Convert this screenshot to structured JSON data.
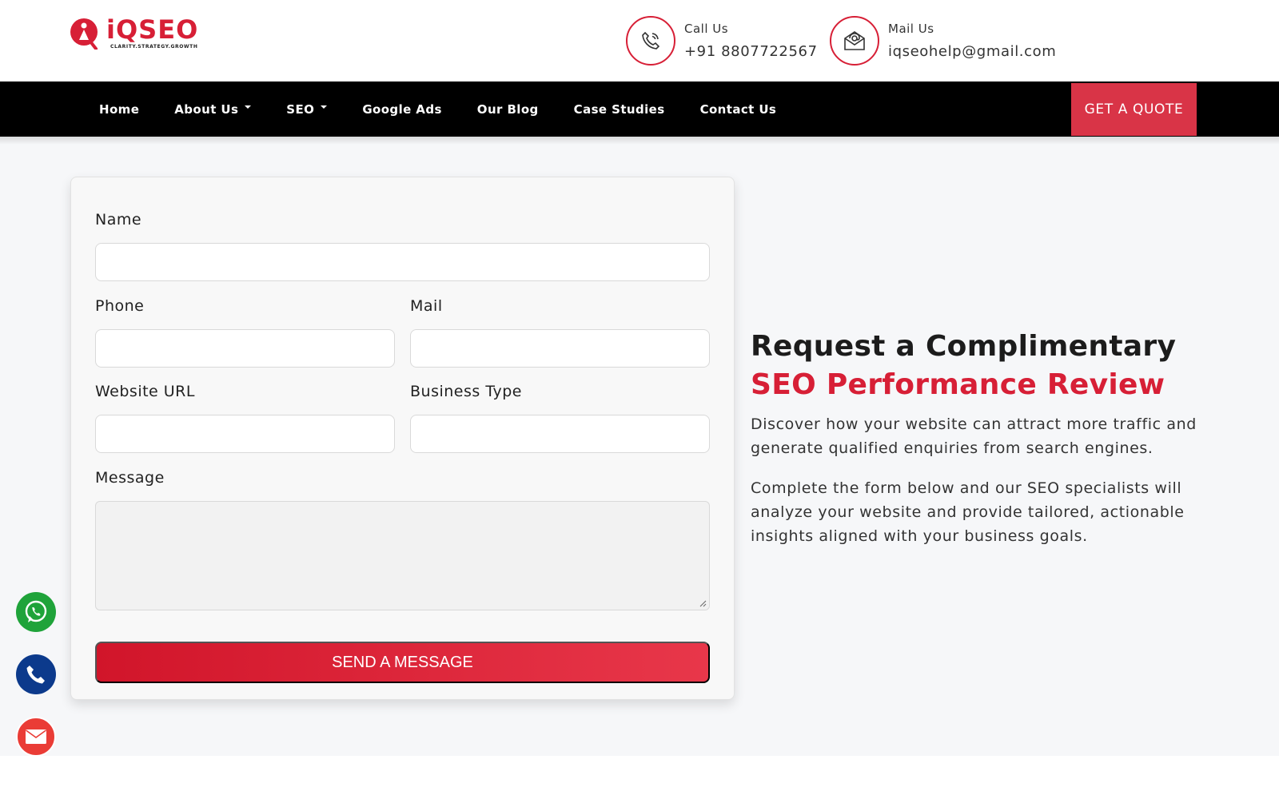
{
  "brand": {
    "name": "iQSEO",
    "tagline": "CLARITY.STRATEGY.GROWTH",
    "accent": "#d71f36"
  },
  "contacts": {
    "call": {
      "label": "Call Us",
      "value": "+91 8807722567",
      "icon": "phone-icon"
    },
    "mail": {
      "label": "Mail Us",
      "value": "iqseohelp@gmail.com",
      "icon": "envelope-icon"
    }
  },
  "nav": {
    "items": [
      {
        "label": "Home",
        "dropdown": false
      },
      {
        "label": "About Us",
        "dropdown": true
      },
      {
        "label": "SEO",
        "dropdown": true
      },
      {
        "label": "Google Ads",
        "dropdown": false
      },
      {
        "label": "Our Blog",
        "dropdown": false
      },
      {
        "label": "Case Studies",
        "dropdown": false
      },
      {
        "label": "Contact Us",
        "dropdown": false
      }
    ],
    "cta": "GET A QUOTE"
  },
  "form": {
    "name_label": "Name",
    "phone_label": "Phone",
    "mail_label": "Mail",
    "website_label": "Website URL",
    "business_label": "Business Type",
    "message_label": "Message",
    "name_value": "",
    "phone_value": "",
    "mail_value": "",
    "website_value": "",
    "business_value": "",
    "message_value": "",
    "submit": "SEND A MESSAGE"
  },
  "promo": {
    "title_plain": "Request a Complimentary ",
    "title_highlight": "SEO Performance Review",
    "para1": "Discover how your website can attract more traffic and generate qualified enquiries from search engines.",
    "para2": "Complete the form below and our SEO specialists will analyze your website and provide tailored, actionable insights aligned with your business goals."
  },
  "floating": [
    {
      "icon": "whatsapp-icon",
      "color": "#1fa33a"
    },
    {
      "icon": "phone-icon",
      "color": "#0c3a8c"
    },
    {
      "icon": "mail-icon",
      "color": "#ea3c36"
    }
  ]
}
